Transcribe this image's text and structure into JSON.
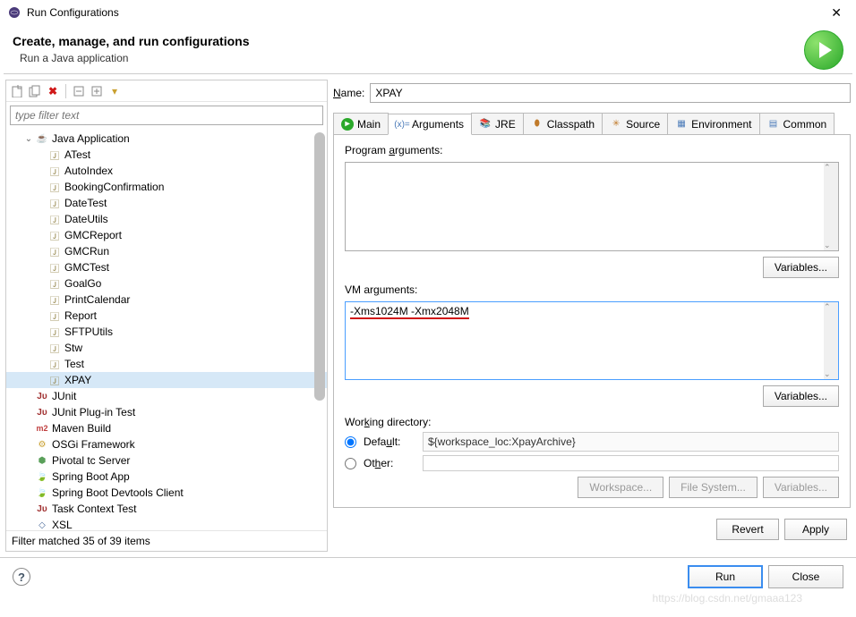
{
  "window": {
    "title": "Run Configurations"
  },
  "header": {
    "title": "Create, manage, and run configurations",
    "subtitle": "Run a Java application"
  },
  "toolbar": {
    "new_icon": "📄",
    "copy_icon": "📋",
    "delete_icon": "✖",
    "expand_icon": "⊟",
    "collapse_icon": "⊟",
    "filter_icon": "▾"
  },
  "filter": {
    "placeholder": "type filter text"
  },
  "tree": {
    "java_app": "Java Application",
    "items": [
      "ATest",
      "AutoIndex",
      "BookingConfirmation",
      "DateTest",
      "DateUtils",
      "GMCReport",
      "GMCRun",
      "GMCTest",
      "GoalGo",
      "PrintCalendar",
      "Report",
      "SFTPUtils",
      "Stw",
      "Test",
      "XPAY"
    ],
    "junit": "JUnit",
    "junit_plugin": "JUnit Plug-in Test",
    "maven": "Maven Build",
    "osgi": "OSGi Framework",
    "pivotal": "Pivotal tc Server",
    "spring_app": "Spring Boot App",
    "spring_devtools": "Spring Boot Devtools Client",
    "task_context": "Task Context Test",
    "xsl": "XSL"
  },
  "filter_status": "Filter matched 35 of 39 items",
  "right": {
    "name_label": "Name:",
    "name_value": "XPAY"
  },
  "tabs": {
    "main": "Main",
    "arguments": "Arguments",
    "jre": "JRE",
    "classpath": "Classpath",
    "source": "Source",
    "environment": "Environment",
    "common": "Common"
  },
  "args": {
    "program_label": "Program arguments:",
    "program_value": "",
    "vm_label": "VM arguments:",
    "vm_value": "-Xms1024M -Xmx2048M",
    "variables_btn": "Variables...",
    "wd_label": "Working directory:",
    "wd_default": "Default:",
    "wd_default_value": "${workspace_loc:XpayArchive}",
    "wd_other": "Other:",
    "wd_other_value": "",
    "workspace_btn": "Workspace...",
    "filesystem_btn": "File System...",
    "wd_variables_btn": "Variables..."
  },
  "footer": {
    "revert": "Revert",
    "apply": "Apply",
    "run": "Run",
    "close": "Close"
  },
  "watermark": "https://blog.csdn.net/gmaaa123"
}
